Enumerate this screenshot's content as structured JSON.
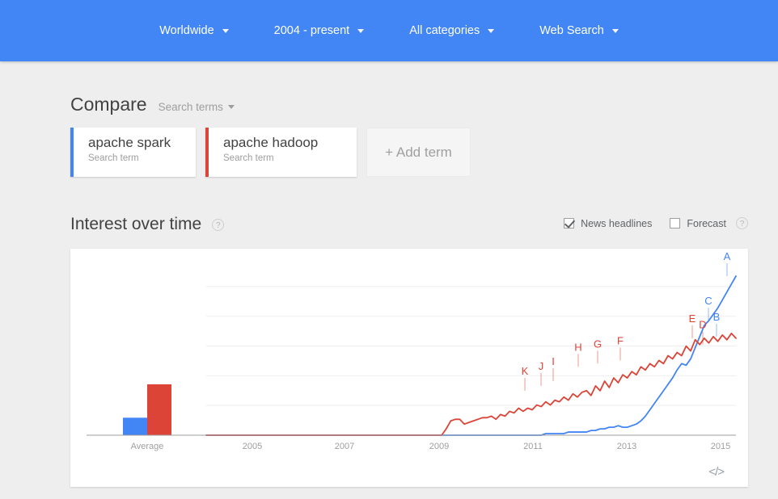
{
  "topbar": {
    "filters": [
      {
        "label": "Worldwide",
        "icon": "chevron-down-icon"
      },
      {
        "label": "2004 - present",
        "icon": "chevron-down-icon"
      },
      {
        "label": "All categories",
        "icon": "chevron-down-icon"
      },
      {
        "label": "Web Search",
        "icon": "chevron-down-icon"
      }
    ],
    "bg_color": "#4285f4"
  },
  "compare": {
    "title": "Compare",
    "kind_label": "Search terms",
    "terms": [
      {
        "name": "apache spark",
        "subtitle": "Search term",
        "color": "#4285f4"
      },
      {
        "name": "apache hadoop",
        "subtitle": "Search term",
        "color": "#dc4437"
      }
    ],
    "add_label": "+ Add term"
  },
  "interest_over_time": {
    "title": "Interest over time",
    "help_icon": "question-mark-icon",
    "options": [
      {
        "label": "News headlines",
        "checked": true
      },
      {
        "label": "Forecast",
        "checked": false
      }
    ],
    "embed_label": "</>"
  },
  "chart_data": {
    "type": "line",
    "title": "Interest over time",
    "xlabel": "",
    "ylabel": "",
    "grid": true,
    "gridlines": 5,
    "ylim": [
      0,
      100
    ],
    "legend_position": "cards-above",
    "x_tick_labels": [
      "Average",
      "2005",
      "2007",
      "2009",
      "2011",
      "2013",
      "2015"
    ],
    "average_panel": {
      "label": "Average",
      "bars": [
        {
          "name": "apache spark",
          "value": 11,
          "color": "#4285f4"
        },
        {
          "name": "apache hadoop",
          "value": 32,
          "color": "#dc4437"
        }
      ]
    },
    "x_range": [
      "2004",
      "2015"
    ],
    "series": [
      {
        "name": "apache spark",
        "color": "#4285f4",
        "values": [
          0,
          0,
          0,
          0,
          0,
          0,
          0,
          0,
          0,
          0,
          0,
          0,
          0,
          0,
          0,
          0,
          0,
          0,
          0,
          0,
          0,
          0,
          0,
          0,
          0,
          0,
          0,
          0,
          0,
          0,
          0,
          0,
          0,
          0,
          0,
          0,
          0,
          0,
          0,
          0,
          0,
          0,
          0,
          0,
          0,
          0,
          0,
          0,
          0,
          0,
          0,
          0,
          0,
          0,
          0,
          0,
          0,
          0,
          0,
          0,
          0,
          0,
          0,
          0,
          0,
          0,
          0,
          0,
          0,
          0,
          0,
          0,
          0,
          0,
          0,
          1,
          1,
          1,
          1,
          1,
          2,
          2,
          2,
          2,
          2,
          3,
          3,
          4,
          4,
          5,
          5,
          6,
          5,
          5,
          6,
          7,
          9,
          12,
          16,
          20,
          24,
          28,
          32,
          36,
          41,
          45,
          44,
          48,
          55,
          62,
          69,
          72,
          76,
          80,
          85,
          90,
          95,
          100
        ],
        "markers": [
          {
            "label": "A",
            "value": 100
          },
          {
            "label": "B",
            "value": 62
          },
          {
            "label": "C",
            "value": 72
          }
        ]
      },
      {
        "name": "apache hadoop",
        "color": "#dc4437",
        "values": [
          0,
          0,
          0,
          0,
          0,
          0,
          0,
          0,
          0,
          0,
          0,
          0,
          0,
          0,
          0,
          0,
          0,
          0,
          0,
          0,
          0,
          0,
          0,
          0,
          0,
          0,
          0,
          0,
          0,
          0,
          0,
          0,
          0,
          0,
          0,
          0,
          0,
          0,
          0,
          0,
          0,
          0,
          0,
          0,
          0,
          0,
          0,
          0,
          0,
          0,
          0,
          0,
          0,
          4,
          9,
          10,
          10,
          7,
          8,
          9,
          10,
          11,
          11,
          12,
          10,
          13,
          12,
          15,
          14,
          17,
          15,
          17,
          16,
          19,
          18,
          21,
          19,
          22,
          21,
          24,
          22,
          26,
          24,
          27,
          28,
          25,
          31,
          28,
          34,
          30,
          36,
          33,
          38,
          36,
          40,
          38,
          43,
          41,
          45,
          43,
          47,
          45,
          50,
          48,
          52,
          50,
          56,
          53,
          60,
          57,
          61,
          58,
          62,
          59,
          63,
          60,
          64,
          61
        ],
        "markers": [
          {
            "label": "D",
            "value": 57
          },
          {
            "label": "E",
            "value": 61
          },
          {
            "label": "F",
            "value": 47
          },
          {
            "label": "G",
            "value": 45
          },
          {
            "label": "H",
            "value": 43
          },
          {
            "label": "I",
            "value": 34
          },
          {
            "label": "J",
            "value": 31
          },
          {
            "label": "K",
            "value": 28
          }
        ]
      }
    ]
  }
}
